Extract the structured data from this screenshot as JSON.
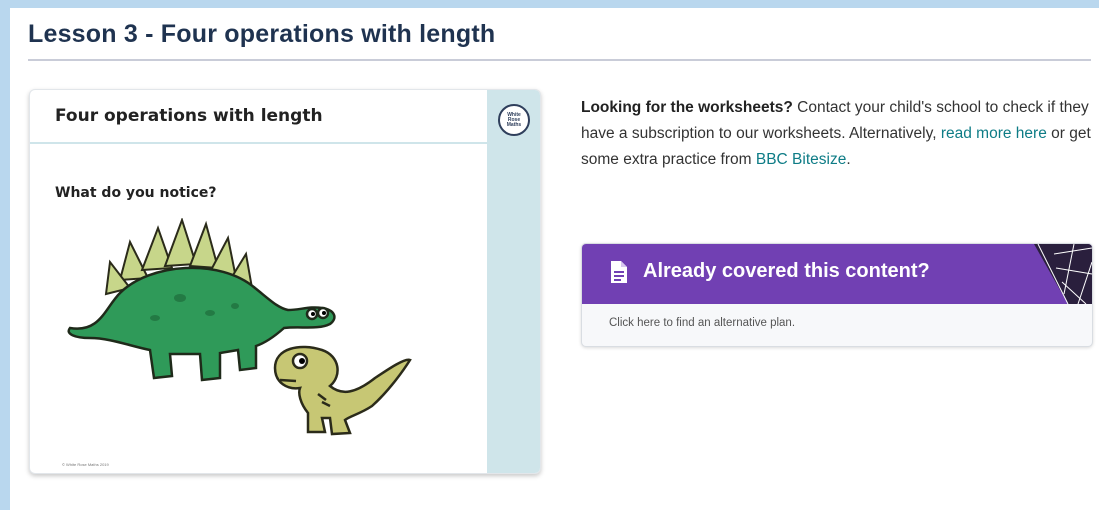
{
  "lesson": {
    "title": "Lesson 3 - Four operations with length"
  },
  "slide": {
    "title": "Four operations with length",
    "question": "What do you notice?",
    "logo_text": "White Rose Maths",
    "footer": "© White Rose Maths 2019"
  },
  "info": {
    "bold_lead": "Looking for the worksheets?",
    "text_1": " Contact your child's school to check if they have a subscription to our worksheets. Alternatively, ",
    "link_1": "read more here",
    "text_2": " or get some extra practice from ",
    "link_2": "BBC Bitesize",
    "text_3": "."
  },
  "alt_plan": {
    "heading": "Already covered this content?",
    "subtext": "Click here to find an alternative plan."
  },
  "colors": {
    "page_background": "#b9d7ee",
    "title": "#1f3350",
    "link": "#0e7c86",
    "banner": "#7140b3",
    "slide_sidebar": "#cfe5ea"
  }
}
